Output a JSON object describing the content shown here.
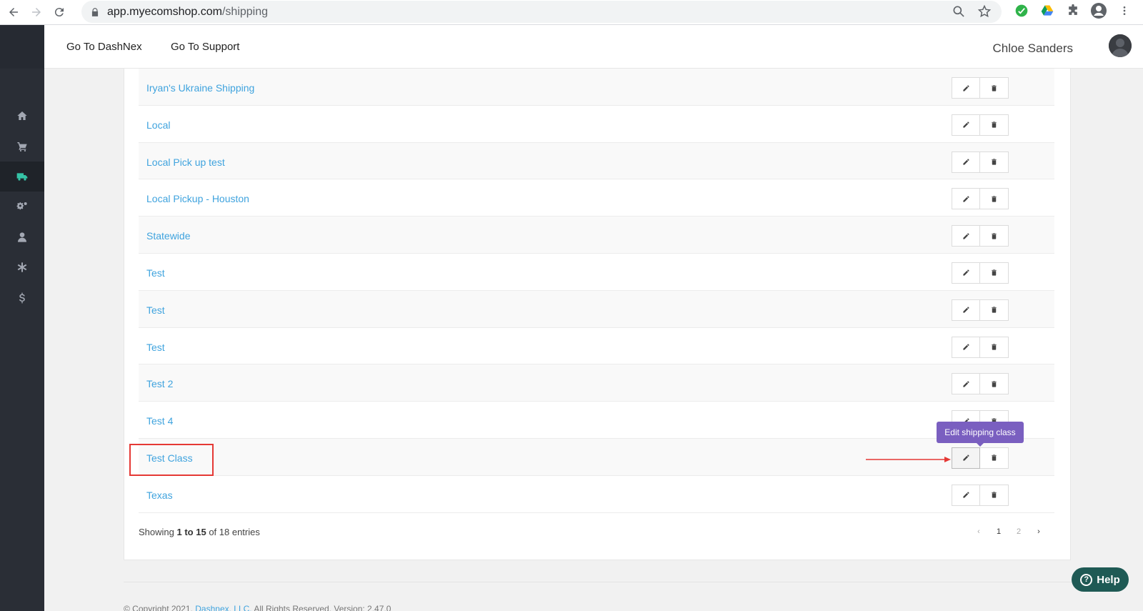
{
  "browser": {
    "url_host": "app.myecomshop.com",
    "url_path": "/shipping"
  },
  "header": {
    "link_dashnex": "Go To DashNex",
    "link_support": "Go To Support",
    "user_name": "Chloe Sanders"
  },
  "sidebar": {
    "items": [
      {
        "icon": "home-icon"
      },
      {
        "icon": "cart-icon"
      },
      {
        "icon": "truck-icon",
        "active": true
      },
      {
        "icon": "cogs-icon"
      },
      {
        "icon": "user-icon"
      },
      {
        "icon": "asterisk-icon"
      },
      {
        "icon": "dollar-icon"
      }
    ]
  },
  "shipping_classes": [
    {
      "name": "Iryan's Ukraine Shipping"
    },
    {
      "name": "Local"
    },
    {
      "name": "Local Pick up test"
    },
    {
      "name": "Local Pickup - Houston"
    },
    {
      "name": "Statewide"
    },
    {
      "name": "Test"
    },
    {
      "name": "Test"
    },
    {
      "name": "Test"
    },
    {
      "name": "Test 2"
    },
    {
      "name": "Test 4"
    },
    {
      "name": "Test Class"
    },
    {
      "name": "Texas"
    }
  ],
  "tooltip": "Edit shipping class",
  "table_footer": {
    "showing_prefix": "Showing",
    "range": "1 to 15",
    "suffix": "of 18 entries"
  },
  "pagination": {
    "prev": "‹",
    "pages": [
      "1",
      "2"
    ],
    "current": "1",
    "next": "›"
  },
  "footer": {
    "copyright_prefix": "© Copyright 2021.",
    "company": "Dashnex, LLC.",
    "copyright_suffix": "All Rights Reserved. Version: 2.47.0"
  },
  "help_label": "Help",
  "colors": {
    "accent": "#35c3a6",
    "link": "#3fa3de",
    "tooltip": "#7a5fc0",
    "help": "#1f5a55",
    "sidebar": "#2a2e36"
  }
}
